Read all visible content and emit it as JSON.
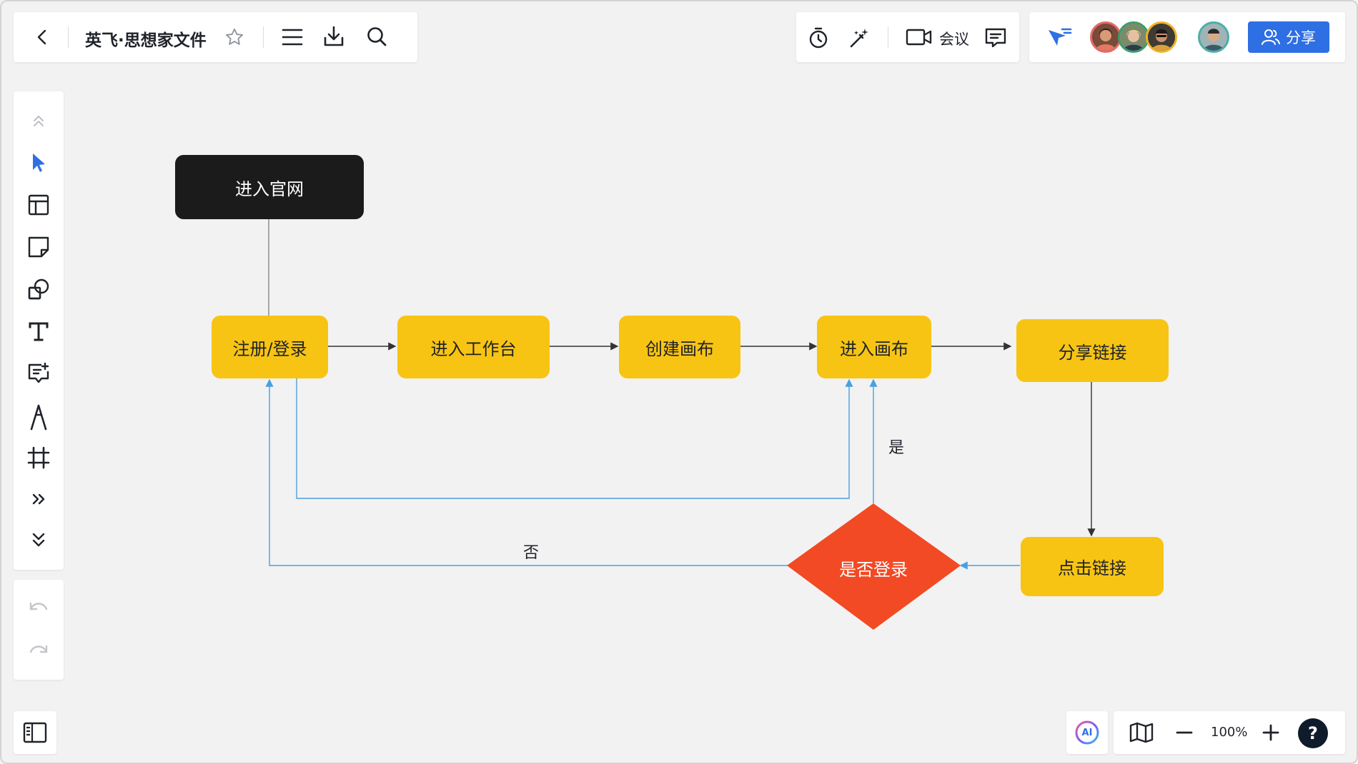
{
  "header": {
    "doc_title": "英飞·思想家文件",
    "icons": [
      "back-icon",
      "star-icon",
      "menu-icon",
      "download-icon",
      "search-icon"
    ]
  },
  "collab": {
    "meeting_label": "会议",
    "share_label": "分享",
    "icons": [
      "timer-icon",
      "magic-wand-icon",
      "video-icon",
      "comment-icon",
      "follow-cursor-icon"
    ],
    "avatars": [
      {
        "name": "avatar-1",
        "color": "#e86a6a"
      },
      {
        "name": "avatar-2",
        "color": "#3a9c6a"
      },
      {
        "name": "avatar-3",
        "color": "#f1b22c"
      },
      {
        "name": "avatar-4",
        "color": "#4ab0a4"
      }
    ]
  },
  "left_toolbar": {
    "tools": [
      "collapse-up-icon",
      "select-tool-icon",
      "template-tool-icon",
      "sticky-note-tool-icon",
      "shape-tool-icon",
      "text-tool-icon",
      "comment-add-tool-icon",
      "pen-tool-icon",
      "frame-tool-icon",
      "more-tools-icon",
      "expand-down-icon"
    ],
    "history": [
      "undo-icon",
      "redo-icon"
    ]
  },
  "bottom": {
    "zoom_label": "100%",
    "ai_label": "AI",
    "help_label": "?"
  },
  "flowchart": {
    "nodes": {
      "start": "进入官网",
      "register": "注册/登录",
      "workspace": "进入工作台",
      "create": "创建画布",
      "enter_canvas": "进入画布",
      "share_link": "分享链接",
      "click_link": "点击链接",
      "decision": "是否登录"
    },
    "edge_labels": {
      "yes": "是",
      "no": "否"
    }
  },
  "colors": {
    "accent": "#2f6fe4",
    "node_yellow": "#f8c413",
    "node_dark": "#1b1b1b",
    "decision_red": "#f24a24",
    "connector_blue": "#4a9fe0",
    "connector_dark": "#333333"
  }
}
